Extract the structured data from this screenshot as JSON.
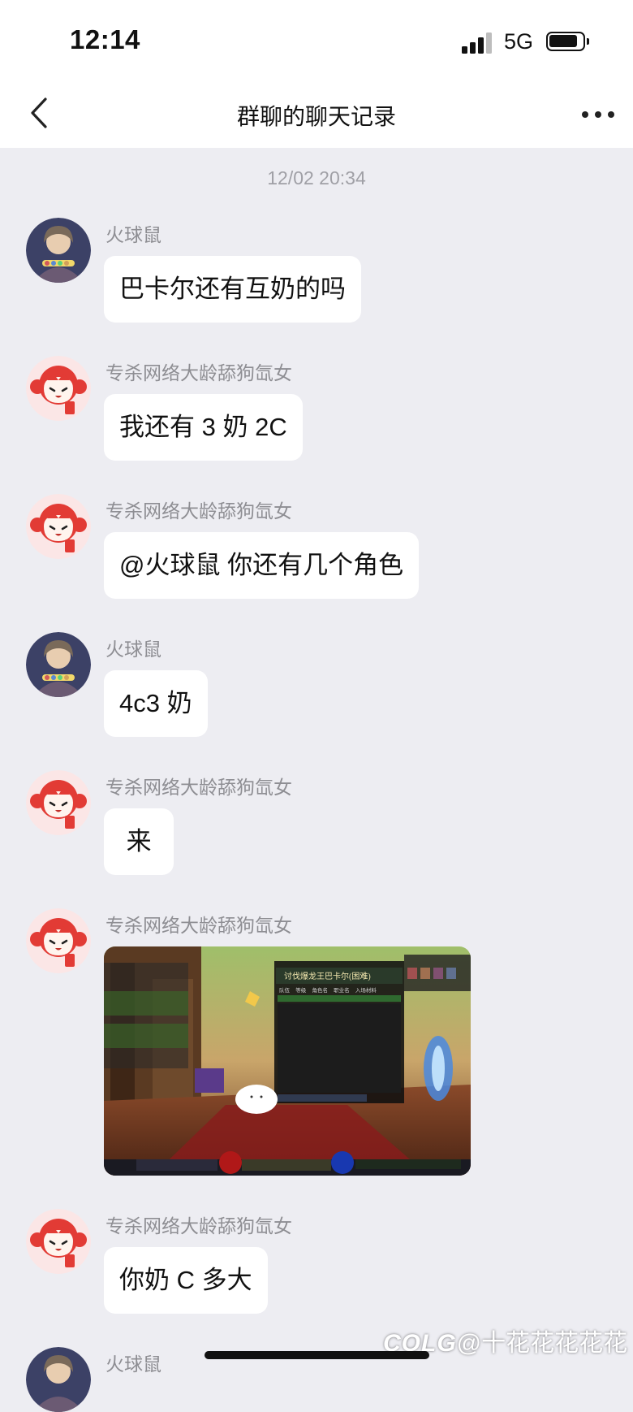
{
  "status": {
    "time": "12:14",
    "network": "5G"
  },
  "nav": {
    "title": "群聊的聊天记录"
  },
  "timestamp": "12/02 20:34",
  "messages": [
    {
      "sender": "火球鼠",
      "text": "巴卡尔还有互奶的吗"
    },
    {
      "sender": "专杀网络大龄舔狗氙女",
      "text": "我还有 3 奶 2C"
    },
    {
      "sender": "专杀网络大龄舔狗氙女",
      "text": "@火球鼠 你还有几个角色"
    },
    {
      "sender": "火球鼠",
      "text": "4c3 奶"
    },
    {
      "sender": "专杀网络大龄舔狗氙女",
      "text": " 来 "
    },
    {
      "sender": "专杀网络大龄舔狗氙女",
      "image": "game-screenshot",
      "image_text": {
        "panel_title": "讨伐爆龙王巴卡尔(困难)",
        "table_header": "队伍    等级    角色名    职业名    入场材料"
      }
    },
    {
      "sender": "专杀网络大龄舔狗氙女",
      "text": "你奶 C 多大"
    },
    {
      "sender": "火球鼠"
    }
  ],
  "watermark": {
    "logo": "COLG",
    "text": "@十花花花花花"
  },
  "colors": {
    "background": "#ededf2",
    "bubble": "#ffffff",
    "sender_text": "#8e8e93",
    "timestamp_text": "#a0a0a6"
  },
  "icons": {
    "back": "chevron-left-icon",
    "more": "more-dots-icon",
    "signal": "signal-bars-icon",
    "battery": "battery-icon"
  }
}
